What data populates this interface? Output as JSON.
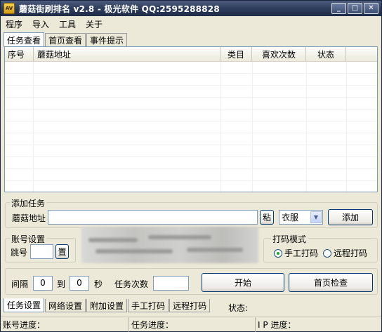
{
  "window": {
    "title": "蘑菇街刷排名 v2.8 - 极光软件 QQ:2595288828",
    "icon_text": "AV",
    "min_icon": "minimize-icon",
    "max_icon": "maximize-icon",
    "close_icon": "close-icon"
  },
  "menu": [
    "程序",
    "导入",
    "工具",
    "关于"
  ],
  "top_tabs": [
    "任务查看",
    "首页查看",
    "事件提示"
  ],
  "list": {
    "columns": [
      "序号",
      "蘑菇地址",
      "类目",
      "喜欢次数",
      "状态"
    ]
  },
  "add_task": {
    "group_title": "添加任务",
    "address_label": "蘑菇地址",
    "address_value": "",
    "paste_label": "粘",
    "category_value": "衣服",
    "add_label": "添加"
  },
  "account": {
    "group_title": "账号设置",
    "number_label": "跳号",
    "number_value": "",
    "set_label": "置"
  },
  "captcha_mode": {
    "group_title": "打码模式",
    "options": [
      "手工打码",
      "远程打码"
    ],
    "selected": 0
  },
  "controls": {
    "interval_label": "间隔",
    "interval_from": "0",
    "to_label": "到",
    "interval_to": "0",
    "sec_label": "秒",
    "task_count_label": "任务次数",
    "task_count_value": "",
    "start_label": "开始",
    "home_check_label": "首页检查"
  },
  "bottom_tabs": [
    "任务设置",
    "网络设置",
    "附加设置",
    "手工打码",
    "远程打码"
  ],
  "status_label": "状态:",
  "statusbar": {
    "account_progress": "账号进度：",
    "task_progress": "任务进度：",
    "ip_progress": "I P 进度："
  }
}
